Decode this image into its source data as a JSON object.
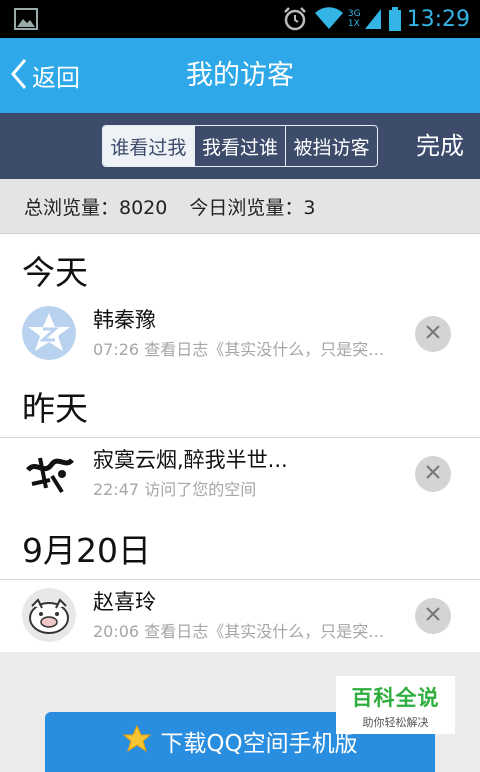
{
  "status_bar": {
    "time": "13:29",
    "network_label": "3G",
    "signal_label": "1X",
    "icons": [
      "gallery-icon",
      "alarm-icon",
      "wifi-icon",
      "signal-icon",
      "battery-icon"
    ]
  },
  "header": {
    "back_label": "返回",
    "title": "我的访客"
  },
  "tabs": {
    "items": [
      {
        "label": "谁看过我",
        "active": true
      },
      {
        "label": "我看过谁",
        "active": false
      },
      {
        "label": "被挡访客",
        "active": false
      }
    ],
    "done_label": "完成"
  },
  "stats": {
    "total_text": "总浏览量：8020",
    "today_text": "今日浏览量：3"
  },
  "sections": [
    {
      "title": "今天",
      "visitors": [
        {
          "name": "韩秦豫",
          "detail": "07:26 查看日志《其实没什么，只是突…"
        }
      ]
    },
    {
      "title": "昨天",
      "visitors": [
        {
          "name": "寂寞云烟,醉我半世...",
          "detail": "22:47 访问了您的空间"
        }
      ]
    },
    {
      "title": "9月20日",
      "visitors": [
        {
          "name": "赵喜玲",
          "detail": "20:06 查看日志《其实没什么，只是突…"
        }
      ]
    }
  ],
  "footer": {
    "download_label": "下载QQ空间手机版",
    "watermark_main": "百科全说",
    "watermark_sub": "助你轻松解决"
  },
  "colors": {
    "accent": "#2ea8e8",
    "tab_bar": "#3d4c6b",
    "status_blue": "#33b5e5",
    "download_button": "#2a8ee0",
    "watermark_green": "#2fae3e"
  }
}
